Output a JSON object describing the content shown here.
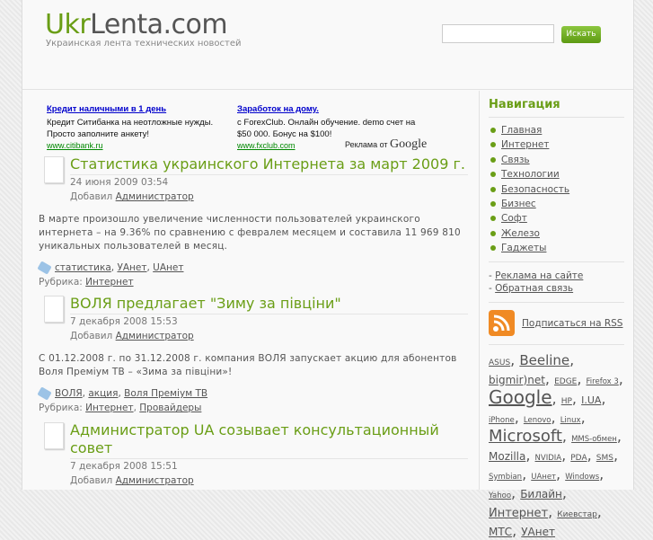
{
  "header": {
    "logo_green": "Ukr",
    "logo_gray": "Lenta.com",
    "tagline": "Украинская лента технических новостей",
    "search_value": "",
    "search_button": "Искать"
  },
  "ads": [
    {
      "title": "Кредит наличными в 1 день",
      "text": "Кредит Ситибанка на неотложные нужды. Просто заполните анкету!",
      "url": "www.citibank.ru"
    },
    {
      "title": "Заработок на дому.",
      "text": "с ForexClub. Онлайн обучение. demo счет на $50 000. Бонус на $100!",
      "url": "www.fxclub.com"
    }
  ],
  "ads_by": "Реклама от",
  "ads_brand": "Google",
  "posts": [
    {
      "title": "Статистика украинского Интернета за март 2009 г.",
      "date": "24 июня 2009 03:54",
      "added_label": "Добавил",
      "author": "Администратор",
      "body": "В марте произошло увеличение численности пользователей украинского интернета – на 9.36% по сравнению с февралем месяцем и составила 11 969 810 уникальных пользователей в месяц.",
      "tags": [
        "статистика",
        "УАнет",
        "UАнет"
      ],
      "rubric_label": "Рубрика:",
      "rubrics": [
        "Интернет"
      ]
    },
    {
      "title": "ВОЛЯ предлагает \"Зиму за півціни\"",
      "date": "7 декабря 2008 15:53",
      "added_label": "Добавил",
      "author": "Администратор",
      "body": "С 01.12.2008 г. по 31.12.2008 г. компания ВОЛЯ запускает акцию для абонентов Воля Преміум ТВ – «Зима за півціни»!",
      "tags": [
        "ВОЛЯ",
        "акция",
        "Воля Преміум ТВ"
      ],
      "rubric_label": "Рубрика:",
      "rubrics": [
        "Интернет",
        "Провайдеры"
      ]
    },
    {
      "title": "Администратор UA созывает консультационный совет",
      "date": "7 декабря 2008 15:51",
      "added_label": "Добавил",
      "author": "Администратор"
    }
  ],
  "sidebar": {
    "nav_title": "Навигация",
    "nav": [
      "Главная",
      "Интернет",
      "Связь",
      "Технологии",
      "Безопасность",
      "Бизнес",
      "Софт",
      "Железо",
      "Гаджеты"
    ],
    "links": [
      "Реклама на сайте",
      "Обратная связь"
    ],
    "rss": "Подписаться на RSS",
    "cloud": [
      "ASUS",
      "Beeline",
      "bigmir)net",
      "EDGE",
      "Firefox 3",
      "Google",
      "HP",
      "I.UA",
      "iPhone",
      "Lenovo",
      "Linux",
      "Microsoft",
      "MMS-обмен",
      "Mozilla",
      "NVIDIA",
      "PDA",
      "SMS",
      "Symbian",
      "UАнет",
      "Windows",
      "Yahoo",
      "Билайн",
      "Интернет",
      "Киевстар",
      "МТС",
      "УАнет"
    ]
  },
  "colors": {
    "accent": "#6a9e16",
    "rss": "#f08a24"
  }
}
